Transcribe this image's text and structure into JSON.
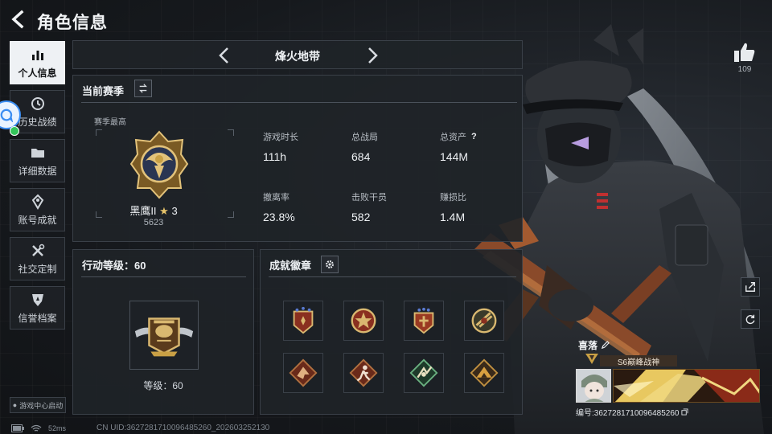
{
  "header": {
    "title": "角色信息"
  },
  "sidebar": {
    "items": [
      {
        "label": "个人信息",
        "icon": "bar-chart-icon",
        "active": true
      },
      {
        "label": "历史战绩",
        "icon": "clock-icon"
      },
      {
        "label": "详细数据",
        "icon": "folder-icon"
      },
      {
        "label": "账号成就",
        "icon": "achievement-icon"
      },
      {
        "label": "社交定制",
        "icon": "tools-icon"
      },
      {
        "label": "信誉档案",
        "icon": "shield-icon"
      }
    ],
    "game_center": "游戏中心启动"
  },
  "mode_selector": {
    "name": "烽火地带"
  },
  "season": {
    "title": "当前赛季",
    "best_label": "赛季最高",
    "rank_name": "黑鹰II",
    "rank_stars": "3",
    "rank_score": "5623",
    "stats": [
      {
        "label": "游戏时长",
        "value": "111h"
      },
      {
        "label": "总战局",
        "value": "684"
      },
      {
        "label": "总资产",
        "value": "144M",
        "help": "?"
      },
      {
        "label": "撤离率",
        "value": "23.8%"
      },
      {
        "label": "击败干员",
        "value": "582"
      },
      {
        "label": "赚损比",
        "value": "1.4M"
      }
    ]
  },
  "level": {
    "title": "行动等级：60",
    "text": "等级：60"
  },
  "badges": {
    "title": "成就徽章",
    "count": 8
  },
  "profile": {
    "likes": "109",
    "player_name": "喜落",
    "title_banner": "S6巅峰战神",
    "uid": "编号:3627281710096485260"
  },
  "status": {
    "ping": "52ms",
    "uid_line": "CN UID:3627281710096485260_202603252130"
  },
  "colors": {
    "accent_gold": "#c9a045",
    "panel_bg": "#1f2328",
    "active_tab": "#eef1f4"
  }
}
